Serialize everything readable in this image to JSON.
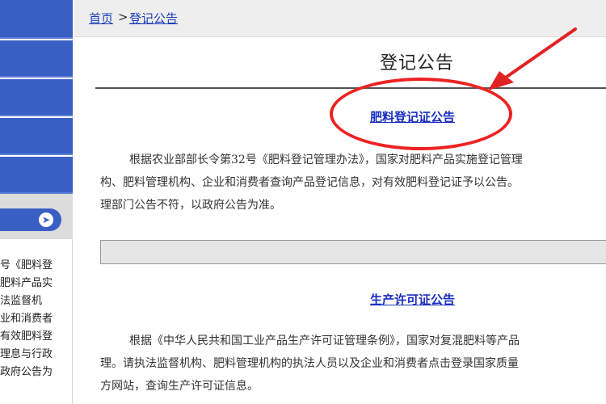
{
  "breadcrumb": {
    "home": "首页",
    "separator": ">",
    "current": "登记公告"
  },
  "page_title": "登记公告",
  "sidebar": {
    "text_lines": [
      "号《肥料登",
      "肥料产品实",
      "法监督机",
      "业和消费者",
      "有效肥料登",
      "理息与行政",
      "政府公告为"
    ]
  },
  "sections": [
    {
      "link": "肥料登记证公告",
      "lines": [
        "根据农业部部长令第32号《肥料登记管理办法》，国家对肥料产品实施登记管理",
        "构、肥料管理机构、企业和消费者查询产品登记信息，对有效肥料登记证予以公告。",
        "理部门公告不符，以政府公告为准。"
      ]
    },
    {
      "link": "生产许可证公告",
      "lines": [
        "根据《中华人民共和国工业产品生产许可证管理条例》，国家对复混肥料等产品",
        "理。请执法监督机构、肥料管理机构的执法人员以及企业和消费者点击登录国家质量",
        "方网站，查询生产许可证信息。"
      ]
    }
  ],
  "colors": {
    "accent_blue": "#3a5fc4",
    "link_blue": "#1a2ec0",
    "annotation_red": "#e22222"
  },
  "icons": {
    "sidebar_arrow": "arrow-right-circle-icon"
  }
}
